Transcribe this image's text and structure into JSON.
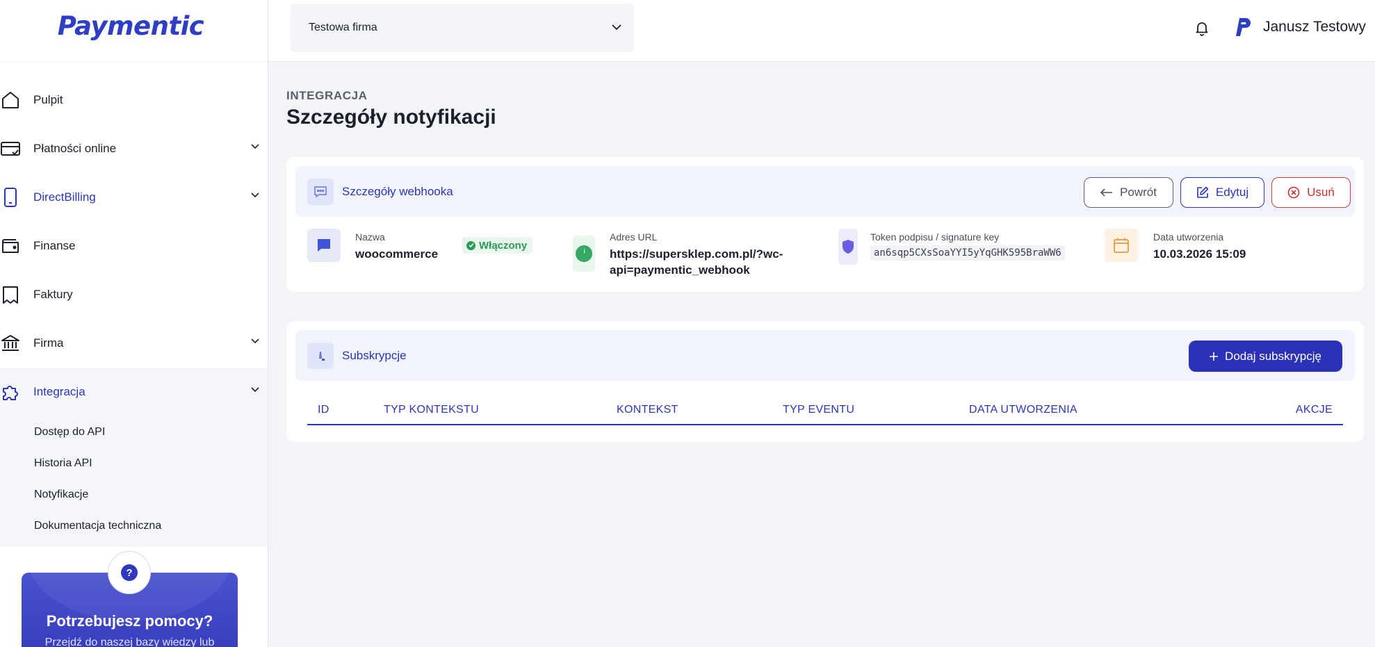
{
  "brand": {
    "logo_text": "Paymentic",
    "accent": "#2b35b5"
  },
  "header": {
    "company_select": "Testowa firma",
    "user_name": "Janusz Testowy"
  },
  "sidebar": {
    "items": [
      {
        "label": "Pulpit",
        "icon": "home-icon"
      },
      {
        "label": "Płatności online",
        "icon": "card-icon"
      },
      {
        "label": "DirectBilling",
        "icon": "phone-icon"
      },
      {
        "label": "Finanse",
        "icon": "wallet-icon"
      },
      {
        "label": "Faktury",
        "icon": "receipt-icon"
      },
      {
        "label": "Firma",
        "icon": "bank-icon"
      },
      {
        "label": "Integracja",
        "icon": "puzzle-icon"
      }
    ],
    "sub_items": [
      "Dostęp do API",
      "Historia API",
      "Notyfikacje",
      "Dokumentacja techniczna"
    ],
    "help": {
      "title": "Potrzebujesz pomocy?",
      "subtitle": "Przejdź do naszej bazy wiedzy lub"
    }
  },
  "page": {
    "breadcrumb": "INTEGRACJA",
    "title": "Szczegóły notyfikacji"
  },
  "webhook_card": {
    "title": "Szczegóły webhooka",
    "buttons": {
      "back": "Powrót",
      "edit": "Edytuj",
      "delete": "Usuń"
    },
    "name_label": "Nazwa",
    "name_value": "woocommerce",
    "status": "Włączony",
    "url_label": "Adres URL",
    "url_line1": "https://supersklep.com.pl/?wc-",
    "url_line2": "api=paymentic_webhook",
    "token_label": "Token podpisu / signature key",
    "token_value": "an6sqp5CXsSoaYYI5yYqGHK595BraWW6",
    "date_label": "Data utworzenia",
    "date_value": "10.03.2026 15:09"
  },
  "subscriptions_card": {
    "title": "Subskrypcje",
    "add_button": "Dodaj subskrypcję",
    "columns": [
      "ID",
      "TYP KONTEKSTU",
      "KONTEKST",
      "TYP EVENTU",
      "DATA UTWORZENIA",
      "AKCJE"
    ]
  }
}
